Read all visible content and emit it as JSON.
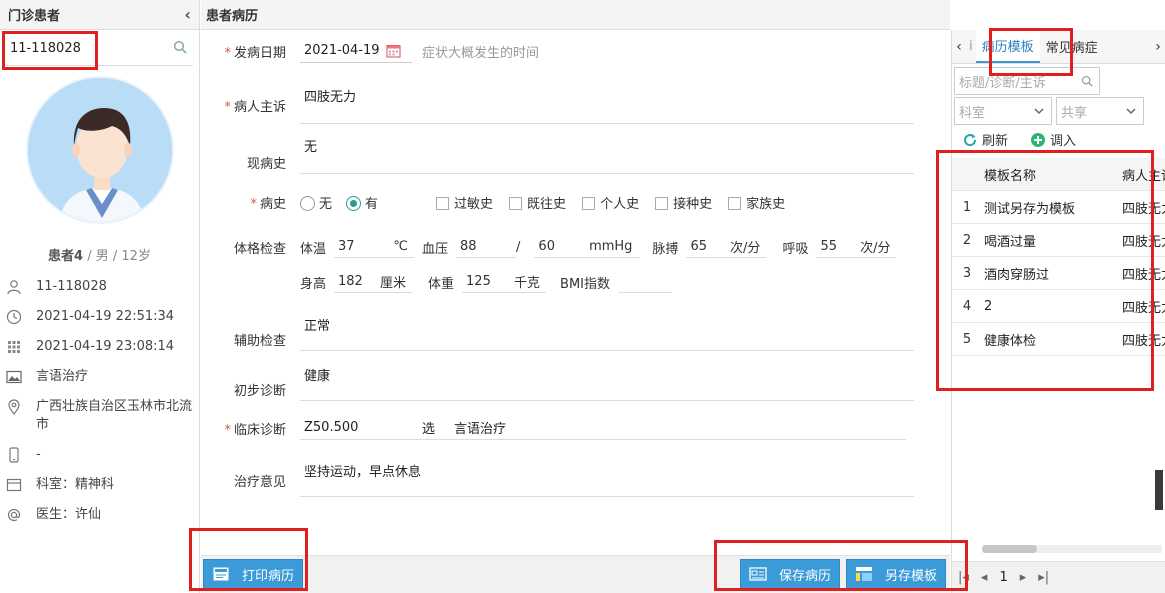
{
  "left": {
    "title": "门诊患者",
    "collapse": "‹",
    "search_value": "11-118028",
    "patient_name": "患者4",
    "patient_sep": " / ",
    "patient_gender": "男",
    "patient_age": "12岁",
    "info": [
      {
        "icon": "user-icon",
        "text": "11-118028"
      },
      {
        "icon": "clock-icon",
        "text": "2021-04-19 22:51:34"
      },
      {
        "icon": "calendar-grid-icon",
        "text": "2021-04-19 23:08:14"
      },
      {
        "icon": "image-icon",
        "text": "言语治疗"
      },
      {
        "icon": "location-pin-icon",
        "text": "广西壮族自治区玉林市北流市"
      },
      {
        "icon": "mobile-icon",
        "text": "-"
      },
      {
        "icon": "department-icon",
        "text": "科室：精神科"
      },
      {
        "icon": "at-icon",
        "text": "医生：许仙"
      }
    ]
  },
  "middle": {
    "title": "患者病历",
    "onset_label": "发病日期",
    "onset_value": "2021-04-19",
    "onset_hint": "症状大概发生的时间",
    "complaint_label": "病人主诉",
    "complaint_value": "四肢无力",
    "present_label": "现病史",
    "present_value": "无",
    "history_label": "病史",
    "history_no": "无",
    "history_yes": "有",
    "history_options": [
      "过敏史",
      "既往史",
      "个人史",
      "接种史",
      "家族史"
    ],
    "exam_label": "体格检查",
    "temp_label": "体温",
    "temp_value": "37",
    "temp_unit": "℃",
    "bp_label": "血压",
    "bp_high": "88",
    "bp_sep": "/",
    "bp_low": "60",
    "bp_unit": "mmHg",
    "pulse_label": "脉搏",
    "pulse_value": "65",
    "pulse_unit": "次/分",
    "resp_label": "呼吸",
    "resp_value": "55",
    "resp_unit": "次/分",
    "height_label": "身高",
    "height_value": "182",
    "height_unit": "厘米",
    "weight_label": "体重",
    "weight_value": "125",
    "weight_unit": "千克",
    "bmi_label": "BMI指数",
    "bmi_value": "",
    "aux_label": "辅助检查",
    "aux_value": "正常",
    "prelim_label": "初步诊断",
    "prelim_value": "健康",
    "clinical_label": "临床诊断",
    "clinical_code": "Z50.500",
    "clinical_select": "选",
    "clinical_value": "言语治疗",
    "treat_label": "治疗意见",
    "treat_value": "坚持运动，早点休息",
    "print_btn": "打印病历",
    "save_btn": "保存病历",
    "save_template_btn": "另存模板"
  },
  "right": {
    "tab_prev": "‹",
    "tab_partial": "i",
    "tab_template": "病历模板",
    "tab_common": "常见病症",
    "tab_next": "›",
    "search_placeholder": "标题/诊断/主诉",
    "dept_placeholder": "科室",
    "share_placeholder": "共享",
    "refresh": "刷新",
    "import": "调入",
    "col_name": "模板名称",
    "col_complaint": "病人主诉",
    "rows": [
      {
        "num": "1",
        "name": "测试另存为模板",
        "complaint": "四肢无力"
      },
      {
        "num": "2",
        "name": "喝酒过量",
        "complaint": "四肢无力"
      },
      {
        "num": "3",
        "name": "酒肉穿肠过",
        "complaint": "四肢无力"
      },
      {
        "num": "4",
        "name": "2",
        "complaint": "四肢无力"
      },
      {
        "num": "5",
        "name": "健康体检",
        "complaint": "四肢无力"
      }
    ],
    "page": "1"
  },
  "colors": {
    "accent": "#3b9ad8",
    "highlight": "#e02020",
    "required": "#d9534f",
    "radio": "#2a9d8f"
  }
}
